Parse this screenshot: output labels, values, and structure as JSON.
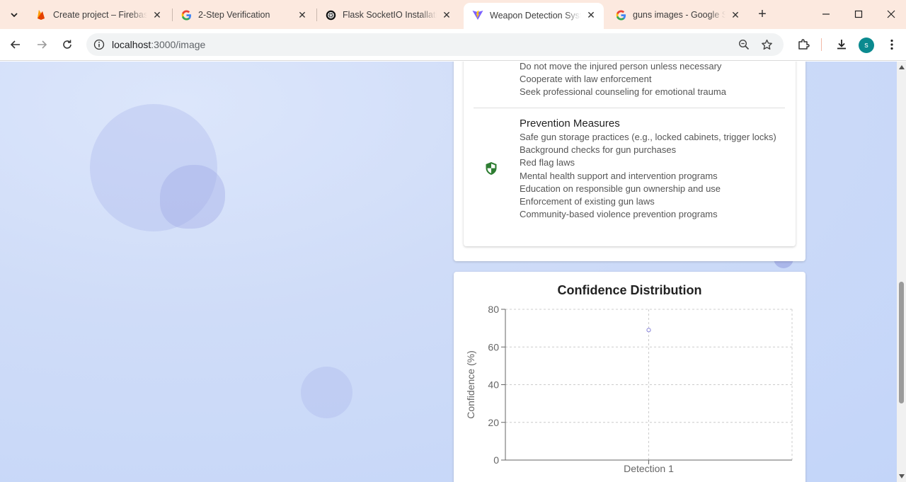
{
  "browser": {
    "tabs": [
      {
        "title": "Create project – Firebase",
        "favicon": "firebase-icon"
      },
      {
        "title": "2-Step Verification",
        "favicon": "google-icon"
      },
      {
        "title": "Flask SocketIO Installation",
        "favicon": "openai-icon"
      },
      {
        "title": "Weapon Detection System",
        "favicon": "vite-icon",
        "active": true
      },
      {
        "title": "guns images - Google Search",
        "favicon": "google-icon"
      }
    ],
    "url_host": "localhost",
    "url_path": ":3000/image",
    "profile_initial": "s"
  },
  "tips": [
    "Do not move the injured person unless necessary",
    "Cooperate with law enforcement",
    "Seek professional counseling for emotional trauma"
  ],
  "prevention": {
    "title": "Prevention Measures",
    "items": [
      "Safe gun storage practices (e.g., locked cabinets, trigger locks)",
      "Background checks for gun purchases",
      "Red flag laws",
      "Mental health support and intervention programs",
      "Education on responsible gun ownership and use",
      "Enforcement of existing gun laws",
      "Community-based violence prevention programs"
    ]
  },
  "chart_data": {
    "type": "line",
    "title": "Confidence Distribution",
    "ylabel": "Confidence (%)",
    "xlabel": "",
    "categories": [
      "Detection 1"
    ],
    "series": [
      {
        "values": [
          69
        ]
      }
    ],
    "ylim": [
      0,
      80
    ],
    "yticks": [
      0,
      20,
      40,
      60,
      80
    ],
    "grid": true,
    "colors": {
      "point": "#8884d8",
      "axis": "#666666",
      "grid": "#cccccc"
    }
  }
}
